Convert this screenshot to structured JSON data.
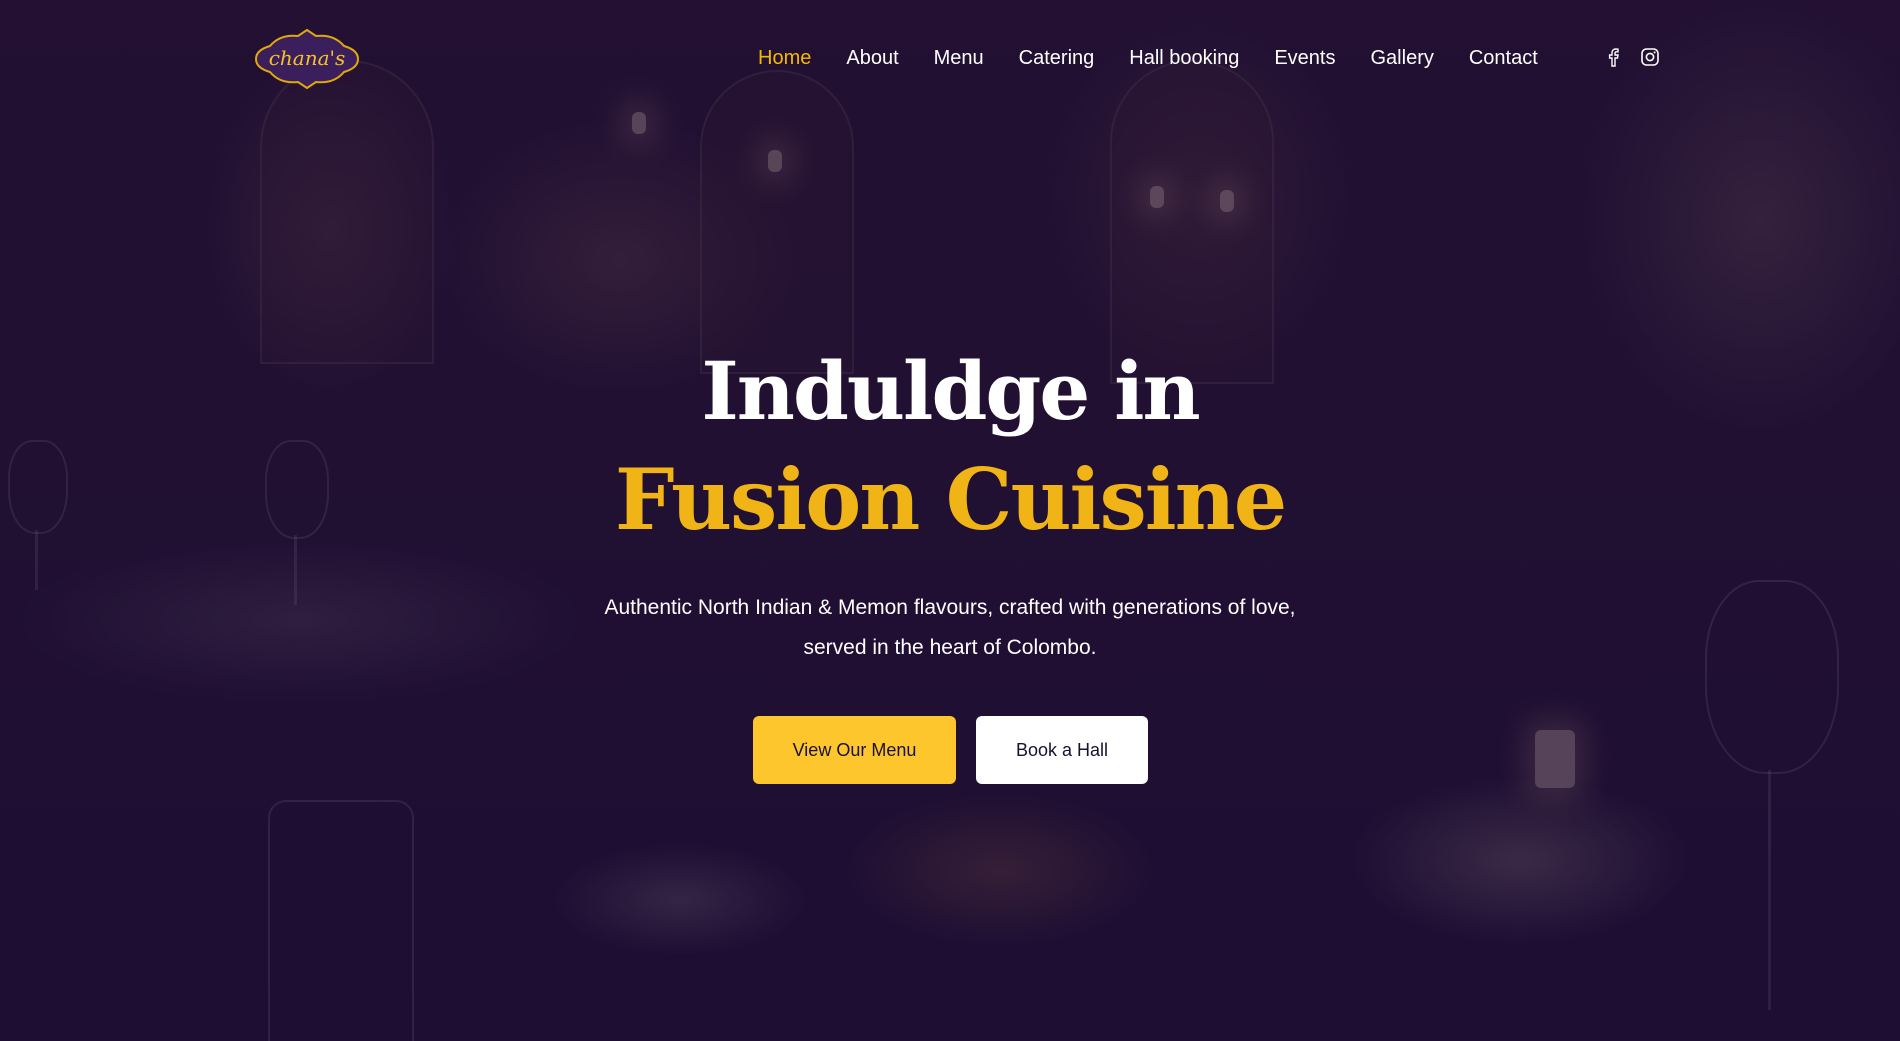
{
  "brand": {
    "logo_text": "chana's",
    "accent": "#f5b800",
    "logo_bg": "#3a1f5c"
  },
  "nav": {
    "items": [
      {
        "label": "Home",
        "active": true
      },
      {
        "label": "About",
        "active": false
      },
      {
        "label": "Menu",
        "active": false
      },
      {
        "label": "Catering",
        "active": false
      },
      {
        "label": "Hall booking",
        "active": false
      },
      {
        "label": "Events",
        "active": false
      },
      {
        "label": "Gallery",
        "active": false
      },
      {
        "label": "Contact",
        "active": false
      }
    ],
    "social": [
      {
        "icon": "facebook-icon"
      },
      {
        "icon": "instagram-icon"
      }
    ]
  },
  "hero": {
    "title_line1": "Induldge in",
    "title_line2": "Fusion Cuisine",
    "subtitle_line1": "Authentic North Indian & Memon flavours, crafted with generations of love,",
    "subtitle_line2": "served in the heart of Colombo.",
    "primary_button": "View Our Menu",
    "secondary_button": "Book a Hall",
    "title_color": "#ffffff",
    "highlight_color": "#f0b416",
    "primary_button_color": "#fdc62c"
  }
}
